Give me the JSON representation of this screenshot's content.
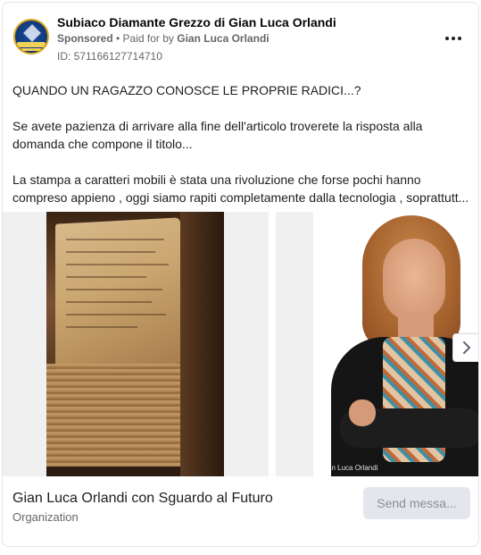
{
  "post": {
    "page_name": "Subiaco Diamante Grezzo di Gian Luca Orlandi",
    "sponsored_label": "Sponsored",
    "separator": " • ",
    "paid_for_prefix": "Paid for by ",
    "payer_name": "Gian Luca Orlandi",
    "ad_id": "ID: 571166127714710",
    "avatar_icon": "page-logo-icon",
    "menu_icon": "more-options-icon"
  },
  "body": {
    "paragraphs": [
      "QUANDO UN RAGAZZO CONOSCE LE PROPRIE RADICI...?",
      "Se avete pazienza di arrivare alla fine dell'articolo troverete la risposta alla domanda che compone il titolo...",
      "La stampa a caratteri mobili è stata una rivoluzione che forse pochi hanno compreso appieno , oggi siamo rapiti completamente dalla tecnologia , soprattutt..."
    ]
  },
  "carousel": {
    "slides": [
      {
        "image": "old-book-image"
      },
      {
        "image": "woman-portrait-image",
        "credit": "Gian Luca Orlandi"
      }
    ],
    "next_icon": "chevron-right-icon"
  },
  "cta": {
    "title": "Gian Luca Orlandi con Sguardo al Futuro",
    "subtitle": "Organization",
    "button_label": "Send messa..."
  }
}
